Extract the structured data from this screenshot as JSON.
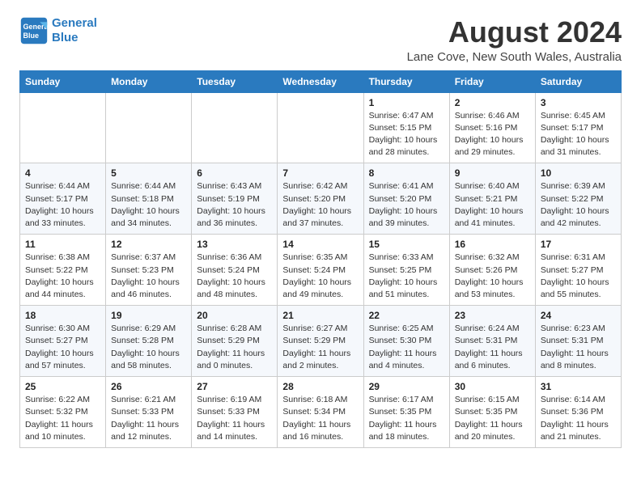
{
  "logo": {
    "line1": "General",
    "line2": "Blue"
  },
  "title": "August 2024",
  "subtitle": "Lane Cove, New South Wales, Australia",
  "weekdays": [
    "Sunday",
    "Monday",
    "Tuesday",
    "Wednesday",
    "Thursday",
    "Friday",
    "Saturday"
  ],
  "weeks": [
    [
      {
        "day": "",
        "info": ""
      },
      {
        "day": "",
        "info": ""
      },
      {
        "day": "",
        "info": ""
      },
      {
        "day": "",
        "info": ""
      },
      {
        "day": "1",
        "info": "Sunrise: 6:47 AM\nSunset: 5:15 PM\nDaylight: 10 hours\nand 28 minutes."
      },
      {
        "day": "2",
        "info": "Sunrise: 6:46 AM\nSunset: 5:16 PM\nDaylight: 10 hours\nand 29 minutes."
      },
      {
        "day": "3",
        "info": "Sunrise: 6:45 AM\nSunset: 5:17 PM\nDaylight: 10 hours\nand 31 minutes."
      }
    ],
    [
      {
        "day": "4",
        "info": "Sunrise: 6:44 AM\nSunset: 5:17 PM\nDaylight: 10 hours\nand 33 minutes."
      },
      {
        "day": "5",
        "info": "Sunrise: 6:44 AM\nSunset: 5:18 PM\nDaylight: 10 hours\nand 34 minutes."
      },
      {
        "day": "6",
        "info": "Sunrise: 6:43 AM\nSunset: 5:19 PM\nDaylight: 10 hours\nand 36 minutes."
      },
      {
        "day": "7",
        "info": "Sunrise: 6:42 AM\nSunset: 5:20 PM\nDaylight: 10 hours\nand 37 minutes."
      },
      {
        "day": "8",
        "info": "Sunrise: 6:41 AM\nSunset: 5:20 PM\nDaylight: 10 hours\nand 39 minutes."
      },
      {
        "day": "9",
        "info": "Sunrise: 6:40 AM\nSunset: 5:21 PM\nDaylight: 10 hours\nand 41 minutes."
      },
      {
        "day": "10",
        "info": "Sunrise: 6:39 AM\nSunset: 5:22 PM\nDaylight: 10 hours\nand 42 minutes."
      }
    ],
    [
      {
        "day": "11",
        "info": "Sunrise: 6:38 AM\nSunset: 5:22 PM\nDaylight: 10 hours\nand 44 minutes."
      },
      {
        "day": "12",
        "info": "Sunrise: 6:37 AM\nSunset: 5:23 PM\nDaylight: 10 hours\nand 46 minutes."
      },
      {
        "day": "13",
        "info": "Sunrise: 6:36 AM\nSunset: 5:24 PM\nDaylight: 10 hours\nand 48 minutes."
      },
      {
        "day": "14",
        "info": "Sunrise: 6:35 AM\nSunset: 5:24 PM\nDaylight: 10 hours\nand 49 minutes."
      },
      {
        "day": "15",
        "info": "Sunrise: 6:33 AM\nSunset: 5:25 PM\nDaylight: 10 hours\nand 51 minutes."
      },
      {
        "day": "16",
        "info": "Sunrise: 6:32 AM\nSunset: 5:26 PM\nDaylight: 10 hours\nand 53 minutes."
      },
      {
        "day": "17",
        "info": "Sunrise: 6:31 AM\nSunset: 5:27 PM\nDaylight: 10 hours\nand 55 minutes."
      }
    ],
    [
      {
        "day": "18",
        "info": "Sunrise: 6:30 AM\nSunset: 5:27 PM\nDaylight: 10 hours\nand 57 minutes."
      },
      {
        "day": "19",
        "info": "Sunrise: 6:29 AM\nSunset: 5:28 PM\nDaylight: 10 hours\nand 58 minutes."
      },
      {
        "day": "20",
        "info": "Sunrise: 6:28 AM\nSunset: 5:29 PM\nDaylight: 11 hours\nand 0 minutes."
      },
      {
        "day": "21",
        "info": "Sunrise: 6:27 AM\nSunset: 5:29 PM\nDaylight: 11 hours\nand 2 minutes."
      },
      {
        "day": "22",
        "info": "Sunrise: 6:25 AM\nSunset: 5:30 PM\nDaylight: 11 hours\nand 4 minutes."
      },
      {
        "day": "23",
        "info": "Sunrise: 6:24 AM\nSunset: 5:31 PM\nDaylight: 11 hours\nand 6 minutes."
      },
      {
        "day": "24",
        "info": "Sunrise: 6:23 AM\nSunset: 5:31 PM\nDaylight: 11 hours\nand 8 minutes."
      }
    ],
    [
      {
        "day": "25",
        "info": "Sunrise: 6:22 AM\nSunset: 5:32 PM\nDaylight: 11 hours\nand 10 minutes."
      },
      {
        "day": "26",
        "info": "Sunrise: 6:21 AM\nSunset: 5:33 PM\nDaylight: 11 hours\nand 12 minutes."
      },
      {
        "day": "27",
        "info": "Sunrise: 6:19 AM\nSunset: 5:33 PM\nDaylight: 11 hours\nand 14 minutes."
      },
      {
        "day": "28",
        "info": "Sunrise: 6:18 AM\nSunset: 5:34 PM\nDaylight: 11 hours\nand 16 minutes."
      },
      {
        "day": "29",
        "info": "Sunrise: 6:17 AM\nSunset: 5:35 PM\nDaylight: 11 hours\nand 18 minutes."
      },
      {
        "day": "30",
        "info": "Sunrise: 6:15 AM\nSunset: 5:35 PM\nDaylight: 11 hours\nand 20 minutes."
      },
      {
        "day": "31",
        "info": "Sunrise: 6:14 AM\nSunset: 5:36 PM\nDaylight: 11 hours\nand 21 minutes."
      }
    ]
  ]
}
